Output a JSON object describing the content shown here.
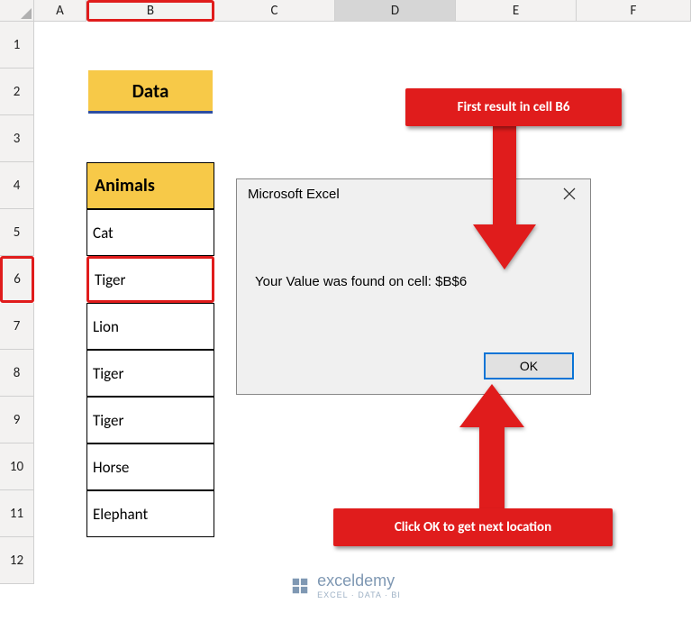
{
  "columns": [
    "A",
    "B",
    "C",
    "D",
    "E",
    "F"
  ],
  "rows": [
    "1",
    "2",
    "3",
    "4",
    "5",
    "6",
    "7",
    "8",
    "9",
    "10",
    "11",
    "12"
  ],
  "header_title": "Data",
  "table_header": "Animals",
  "table_values": [
    "Cat",
    "Tiger",
    "Lion",
    "Tiger",
    "Tiger",
    "Horse",
    "Elephant"
  ],
  "dialog": {
    "title": "Microsoft Excel",
    "message": "Your Value was found on cell: $B$6",
    "ok": "OK"
  },
  "callouts": {
    "top": "First result in cell B6",
    "bottom": "Click OK to get next location"
  },
  "watermark": {
    "brand": "exceldemy",
    "sub": "EXCEL · DATA · BI"
  }
}
